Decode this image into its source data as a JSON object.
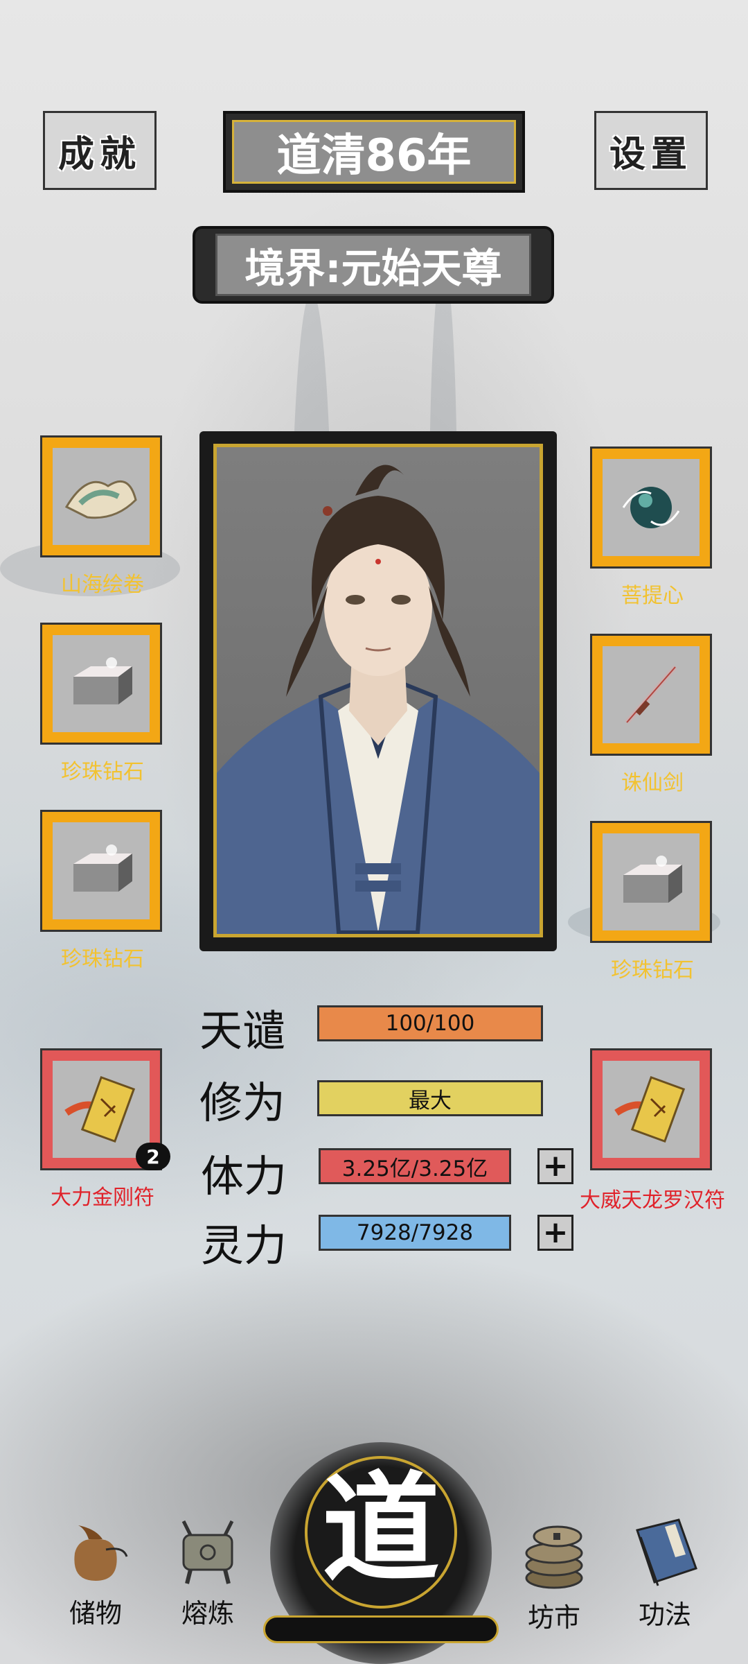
{
  "header": {
    "achievement_label": "成就",
    "settings_label": "设置",
    "era_title": "道清86年",
    "realm_title": "境界:元始天尊"
  },
  "equipment_left": [
    {
      "label": "山海绘卷",
      "icon": "scroll-map-icon"
    },
    {
      "label": "珍珠钻石",
      "icon": "diamond-block-icon"
    },
    {
      "label": "珍珠钻石",
      "icon": "diamond-block-icon"
    }
  ],
  "equipment_right": [
    {
      "label": "菩提心",
      "icon": "jade-orb-icon"
    },
    {
      "label": "诛仙剑",
      "icon": "sword-icon"
    },
    {
      "label": "珍珠钻石",
      "icon": "diamond-block-icon"
    }
  ],
  "talismans": [
    {
      "label": "大力金刚符",
      "count": "2",
      "icon": "talisman-icon"
    },
    {
      "label": "大威天龙罗汉符",
      "icon": "talisman-icon"
    }
  ],
  "stats": [
    {
      "name": "天谴",
      "value": "100/100",
      "color": "#e8894a",
      "has_plus": false
    },
    {
      "name": "修为",
      "value": "最大",
      "color": "#e2d160",
      "has_plus": false
    },
    {
      "name": "体力",
      "value": "3.25亿/3.25亿",
      "color": "#e05a5a",
      "has_plus": true
    },
    {
      "name": "灵力",
      "value": "7928/7928",
      "color": "#7fb8e6",
      "has_plus": true
    }
  ],
  "plus_symbol": "+",
  "nav": {
    "storage": "储物",
    "smelt": "熔炼",
    "center": "道",
    "market": "坊市",
    "skills": "功法"
  },
  "colors": {
    "slot_gold": "#f3a715",
    "slot_red": "#e25858",
    "label_gold": "#f2c230",
    "label_red": "#e0222a"
  }
}
